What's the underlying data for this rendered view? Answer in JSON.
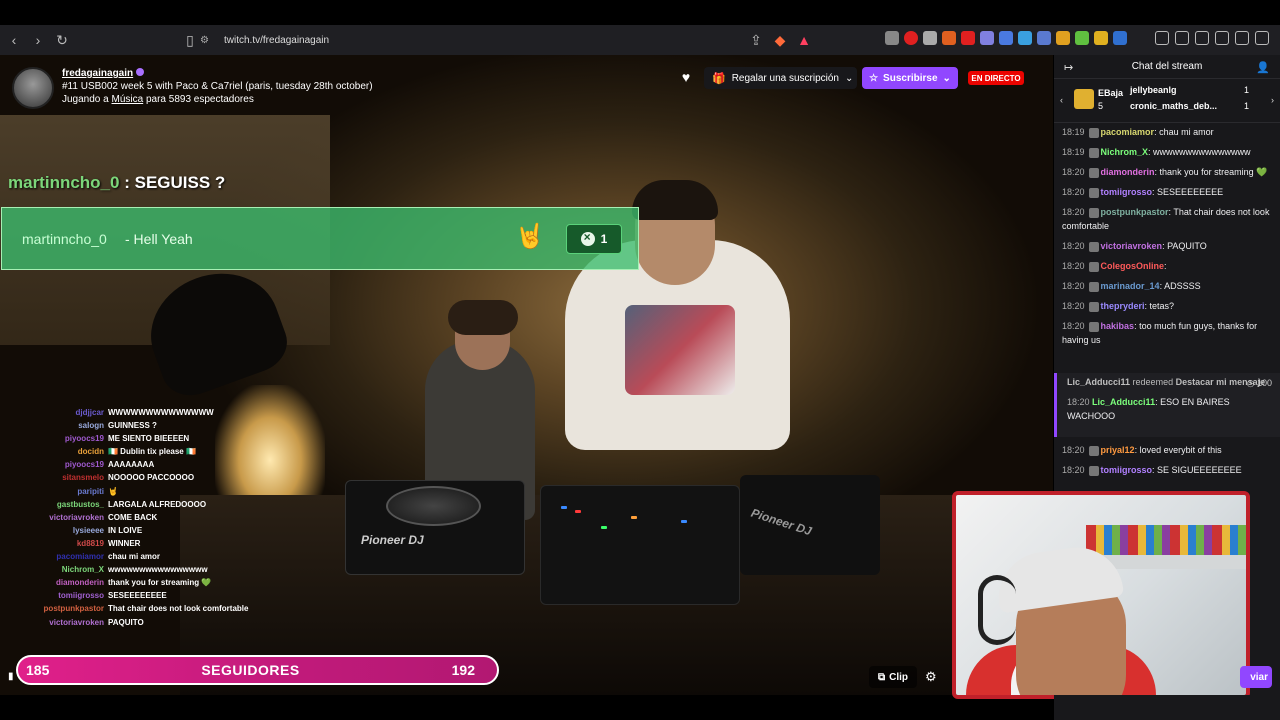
{
  "browser": {
    "url": "twitch.tv/fredagainagain"
  },
  "channel": {
    "name": "fredagainagain",
    "title": "#11 USB002 week 5 with Paco & Ca7riel (paris, tuesday 28th october)",
    "game_prefix": "Jugando a",
    "game": "Música",
    "viewers_text": "para 5893 espectadores",
    "gift_label": "Regalar una suscripción",
    "subscribe_label": "Suscribirse",
    "live_label": "EN DIRECTO"
  },
  "overlay": {
    "highlight_user": "martinncho_0",
    "highlight_text": ": SEGUISS ?",
    "alert_user": "martinncho_0",
    "alert_msg": "- Hell Yeah",
    "alert_count": "1",
    "followers_current": "185",
    "followers_label": "SEGUIDORES",
    "followers_goal": "192",
    "chat": [
      {
        "user": "djdjjcar",
        "text": "WWWWWWWWWWWWWW",
        "color": "#6a5acd"
      },
      {
        "user": "salogn",
        "text": "GUINNESS ?",
        "color": "#9ad"
      },
      {
        "user": "piyoocs19",
        "text": "ME SIENTO BIEEEEN",
        "color": "#a05ad0"
      },
      {
        "user": "docidn",
        "text": "🇮🇪 Dublin tix please 🇮🇪",
        "color": "#e8a03a"
      },
      {
        "user": "piyoocs19",
        "text": "AAAAAAAA",
        "color": "#a05ad0"
      },
      {
        "user": "sitansmelo",
        "text": "NOOOOO PACCOOOO",
        "color": "#c03030"
      },
      {
        "user": "paripiti",
        "text": "🤘",
        "color": "#6a7ad0"
      },
      {
        "user": "gastbustos_",
        "text": "LARGALA ALFREDOOOO",
        "color": "#7cd67a"
      },
      {
        "user": "victoriavroken",
        "text": "COME BACK",
        "color": "#b070d0"
      },
      {
        "user": "lysieeee",
        "text": "IN LOIVE",
        "color": "#9ad"
      },
      {
        "user": "kd8819",
        "text": "WINNER",
        "color": "#d04a4a"
      },
      {
        "user": "pacomiamor",
        "text": "chau mi amor",
        "color": "#3030b0"
      },
      {
        "user": "Nichrom_X",
        "text": "wwwwwwwwwwwwwwww",
        "color": "#7cd67a"
      },
      {
        "user": "diamonderin",
        "text": "thank you for streaming 💚",
        "color": "#c060c0"
      },
      {
        "user": "tomiigrosso",
        "text": "SESEEEEEEEE",
        "color": "#a060d0"
      },
      {
        "user": "postpunkpastor",
        "text": "That chair does not look comfortable",
        "color": "#d06040"
      },
      {
        "user": "victoriavroken",
        "text": "PAQUITO",
        "color": "#b070d0"
      }
    ]
  },
  "controls": {
    "clip_label": "Clip"
  },
  "chat": {
    "header": "Chat del stream",
    "gift_user": "EBaja",
    "gift_count": "5",
    "top1": "jellybeanlg",
    "top2": "cronic_maths_deb...",
    "top1_count": "1",
    "top2_count": "1",
    "messages": [
      {
        "time": "18:19",
        "user": "pacomiamor",
        "color": "#d8d870",
        "text": ": chau mi amor"
      },
      {
        "time": "18:19",
        "user": "Nichrom_X",
        "color": "#7cff7c",
        "text": ": wwwwwwwwwwwwwww"
      },
      {
        "time": "18:20",
        "user": "diamonderin",
        "color": "#e070e0",
        "text": ": thank you for streaming 💚"
      },
      {
        "time": "18:20",
        "user": "tomiigrosso",
        "color": "#b080ff",
        "text": ": SESEEEEEEEE"
      },
      {
        "time": "18:20",
        "user": "postpunkpastor",
        "color": "#7fb0a0",
        "text": ": That chair does not look comfortable"
      },
      {
        "time": "18:20",
        "user": "victoriavroken",
        "color": "#c070e0",
        "text": ": PAQUITO"
      },
      {
        "time": "18:20",
        "user": "ColegosOnline",
        "color": "#ff5a5a",
        "text": ": "
      },
      {
        "time": "18:20",
        "user": "marinador_14",
        "color": "#6a9ad0",
        "text": ": ADSSSS"
      },
      {
        "time": "18:20",
        "user": "thepryderi",
        "color": "#9a8aff",
        "text": ": tetas?"
      },
      {
        "time": "18:20",
        "user": "hakibas",
        "color": "#c070e0",
        "text": ": too much fun guys, thanks for having us"
      }
    ],
    "redeem_user": "Lic_Adducci11",
    "redeem_text": "redeemed",
    "redeem_reward": "Destacar mi mensaje",
    "redeem_points": "100",
    "redeem_time": "18:20",
    "redeem_msg_user": "Lic_Adducci11",
    "redeem_msg": ": ESO EN BAIRES WACHOOO",
    "after": [
      {
        "time": "18:20",
        "user": "priyal12",
        "color": "#ff9a40",
        "text": ": loved everybit of this"
      },
      {
        "time": "18:20",
        "user": "tomiigrosso",
        "color": "#b080ff",
        "text": ": SE SIGUEEEEEEEE"
      }
    ],
    "send_label": "viar"
  }
}
